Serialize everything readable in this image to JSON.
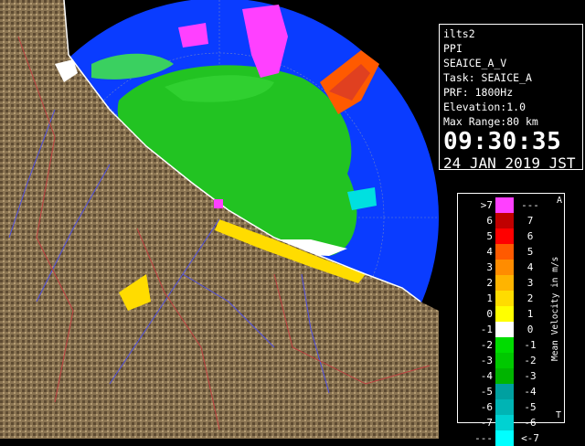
{
  "info": {
    "station": "ilts2",
    "mode": "PPI",
    "product": "SEAICE_A_V",
    "task": "Task: SEAICE_A",
    "prf": "PRF: 1800Hz",
    "elevation": "Elevation:1.0",
    "max_range": "Max Range:80 km",
    "time": "09:30:35",
    "date": "24 JAN 2019 JST"
  },
  "legend": {
    "title": "Mean Velocity in m/s",
    "top_marker": "A",
    "bottom_marker": "T",
    "rows": [
      {
        "lo": ">7",
        "hi": "---",
        "color": "#ff40ff"
      },
      {
        "lo": "6",
        "hi": "7",
        "color": "#c00000"
      },
      {
        "lo": "5",
        "hi": "6",
        "color": "#ff0000"
      },
      {
        "lo": "4",
        "hi": "5",
        "color": "#ff5a00"
      },
      {
        "lo": "3",
        "hi": "4",
        "color": "#ff8c00"
      },
      {
        "lo": "2",
        "hi": "3",
        "color": "#ffb400"
      },
      {
        "lo": "1",
        "hi": "2",
        "color": "#ffdc00"
      },
      {
        "lo": "0",
        "hi": "1",
        "color": "#ffff00"
      },
      {
        "lo": "-1",
        "hi": "0",
        "color": "#ffffff"
      },
      {
        "lo": "-2",
        "hi": "-1",
        "color": "#00dc00"
      },
      {
        "lo": "-3",
        "hi": "-2",
        "color": "#00c800"
      },
      {
        "lo": "-4",
        "hi": "-3",
        "color": "#00b400"
      },
      {
        "lo": "-5",
        "hi": "-4",
        "color": "#00a0a0"
      },
      {
        "lo": "-6",
        "hi": "-5",
        "color": "#00b4b4"
      },
      {
        "lo": "-7",
        "hi": "-6",
        "color": "#00d2d2"
      },
      {
        "lo": "---",
        "hi": "<-7",
        "color": "#00ffff"
      }
    ]
  },
  "colors": {
    "radar_background": "#0a3cff",
    "terrain": "#8a7452",
    "coastline": "#ffffff",
    "rivers": "#5050e0",
    "borders": "#c04040"
  }
}
